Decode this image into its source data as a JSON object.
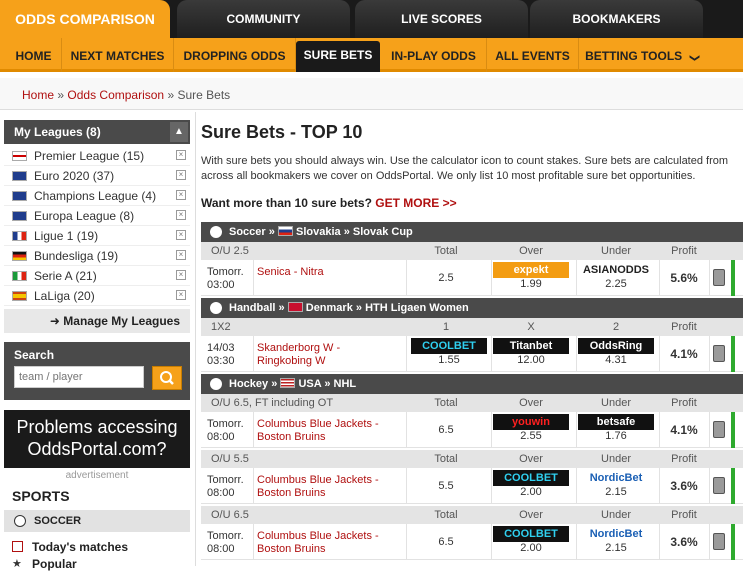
{
  "top_tabs": [
    "ODDS COMPARISON",
    "COMMUNITY",
    "LIVE SCORES",
    "BOOKMAKERS"
  ],
  "nav": [
    "HOME",
    "NEXT MATCHES",
    "DROPPING ODDS",
    "SURE BETS",
    "IN-PLAY ODDS",
    "ALL EVENTS",
    "BETTING TOOLS"
  ],
  "nav_caret": "❯",
  "breadcrumb": {
    "home": "Home",
    "sep": "»",
    "odds": "Odds Comparison",
    "current": "Sure Bets"
  },
  "sidebar": {
    "my_leagues": "My Leagues (8)",
    "leagues": [
      {
        "label": "Premier League",
        "count": "(15)",
        "flag": "eng"
      },
      {
        "label": "Euro 2020",
        "count": "(37)",
        "flag": "eu"
      },
      {
        "label": "Champions League",
        "count": "(4)",
        "flag": "eu"
      },
      {
        "label": "Europa League",
        "count": "(8)",
        "flag": "eu"
      },
      {
        "label": "Ligue 1",
        "count": "(19)",
        "flag": "fr"
      },
      {
        "label": "Bundesliga",
        "count": "(19)",
        "flag": "de"
      },
      {
        "label": "Serie A",
        "count": "(21)",
        "flag": "it"
      },
      {
        "label": "LaLiga",
        "count": "(20)",
        "flag": "es"
      }
    ],
    "manage": "Manage My Leagues",
    "search_label": "Search",
    "search_placeholder": "team / player",
    "ad_line1": "Problems accessing",
    "ad_line2": "OddsPortal.com?",
    "ad_label": "advertisement",
    "sports_title": "SPORTS",
    "sport_soccer": "SOCCER",
    "todays_matches": "Today's matches",
    "popular": "Popular"
  },
  "main": {
    "title": "Sure Bets - TOP 10",
    "intro": "With sure bets you should always win. Use the calculator icon to count stakes. Sure bets are calculated from across all bookmakers we cover on OddsPortal. We only list 10 most profitable sure bet opportunities.",
    "more_prefix": "Want more than 10 sure bets?",
    "more_link": "GET MORE >>"
  },
  "groups": [
    {
      "sport": "Soccer",
      "country": "Slovakia",
      "league": "Slovak Cup",
      "flag": "sk",
      "blocks": [
        {
          "market": "O/U 2.5",
          "h_total": "Total",
          "h1": "Over",
          "h2": "Under",
          "h_profit": "Profit",
          "three": false,
          "time1": "Tomorr.",
          "time2": "03:00",
          "match": "Senica - Nitra",
          "total": "2.5",
          "b1": "expekt",
          "o1": "1.99",
          "b2": "ASIANODDS",
          "o2": "2.25",
          "profit": "5.6%"
        }
      ]
    },
    {
      "sport": "Handball",
      "country": "Denmark",
      "league": "HTH Ligaen Women",
      "flag": "dk",
      "blocks": [
        {
          "market": "1X2",
          "h_total": "1",
          "h1": "X",
          "h2": "2",
          "h_profit": "Profit",
          "three": true,
          "time1": "14/03",
          "time2": "03:30",
          "match": "Skanderborg W - Ringkobing W",
          "b0": "COOLBET",
          "o0": "1.55",
          "b1": "Titanbet",
          "o1": "12.00",
          "b2": "OddsRing",
          "o2": "4.31",
          "profit": "4.1%"
        }
      ]
    },
    {
      "sport": "Hockey",
      "country": "USA",
      "league": "NHL",
      "flag": "us",
      "blocks": [
        {
          "market": "O/U 6.5, FT including OT",
          "h_total": "Total",
          "h1": "Over",
          "h2": "Under",
          "h_profit": "Profit",
          "three": false,
          "time1": "Tomorr.",
          "time2": "08:00",
          "match": "Columbus Blue Jackets - Boston Bruins",
          "total": "6.5",
          "b1": "youwin",
          "o1": "2.55",
          "b2": "betsafe",
          "o2": "1.76",
          "profit": "4.1%"
        },
        {
          "market": "O/U 5.5",
          "h_total": "Total",
          "h1": "Over",
          "h2": "Under",
          "h_profit": "Profit",
          "three": false,
          "time1": "Tomorr.",
          "time2": "08:00",
          "match": "Columbus Blue Jackets - Boston Bruins",
          "total": "5.5",
          "b1": "COOLBET",
          "o1": "2.00",
          "b2": "NordicBet",
          "o2": "2.15",
          "profit": "3.6%"
        },
        {
          "market": "O/U 6.5",
          "h_total": "Total",
          "h1": "Over",
          "h2": "Under",
          "h_profit": "Profit",
          "three": false,
          "time1": "Tomorr.",
          "time2": "08:00",
          "match": "Columbus Blue Jackets - Boston Bruins",
          "total": "6.5",
          "b1": "COOLBET",
          "o1": "2.00",
          "b2": "NordicBet",
          "o2": "2.15",
          "profit": "3.6%"
        }
      ]
    }
  ],
  "colors": {
    "accent": "#f6a11a",
    "dark": "#1a1a1a",
    "link": "#b01010",
    "profit_bar": "#2eaa2e"
  },
  "logo_colors": {
    "expekt": "#f39c12",
    "ASIANODDS": "#ffffff",
    "COOLBET": "#111111",
    "Titanbet": "#111111",
    "OddsRing": "#111111",
    "youwin": "#111111",
    "betsafe": "#111111",
    "NordicBet": "#ffffff"
  },
  "logo_text_colors": {
    "expekt": "#ffffff",
    "ASIANODDS": "#222222",
    "COOLBET": "#2fd0f0",
    "Titanbet": "#ffffff",
    "OddsRing": "#ffffff",
    "youwin": "#ff2020",
    "betsafe": "#ffffff",
    "NordicBet": "#1a5fb4"
  }
}
